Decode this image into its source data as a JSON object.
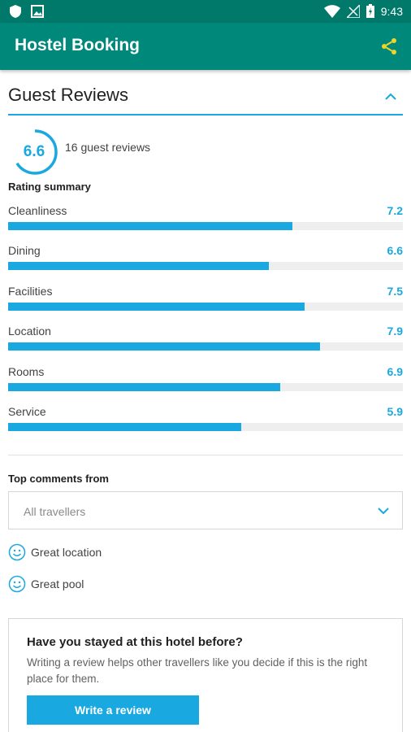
{
  "status_bar": {
    "time": "9:43"
  },
  "app_bar": {
    "title": "Hostel Booking"
  },
  "section": {
    "title": "Guest Reviews"
  },
  "overall": {
    "score": "6.6",
    "score_fraction": 0.66,
    "reviews_count": "16 guest reviews"
  },
  "summary_label": "Rating summary",
  "ratings": [
    {
      "name": "Cleanliness",
      "score": "7.2",
      "value": 7.2
    },
    {
      "name": "Dining",
      "score": "6.6",
      "value": 6.6
    },
    {
      "name": "Facilities",
      "score": "7.5",
      "value": 7.5
    },
    {
      "name": "Location",
      "score": "7.9",
      "value": 7.9
    },
    {
      "name": "Rooms",
      "score": "6.9",
      "value": 6.9
    },
    {
      "name": "Service",
      "score": "5.9",
      "value": 5.9
    }
  ],
  "rating_max": 10,
  "top_comments": {
    "label": "Top comments from",
    "filter_value": "All travellers",
    "items": [
      "Great location",
      "Great pool"
    ]
  },
  "cta": {
    "title": "Have you stayed at this hotel before?",
    "description": "Writing a review helps other travellers like you decide if this is the right place for them.",
    "button_label": "Write a review"
  },
  "colors": {
    "primary": "#00897b",
    "status_bar": "#00796b",
    "accent": "#1aa8e0",
    "share_icon": "#f2d32c"
  },
  "icons": [
    "shield-icon",
    "image-icon",
    "wifi-icon",
    "signal-icon",
    "battery-icon",
    "share-icon",
    "chevron-up-icon",
    "chevron-down-icon",
    "smiley-icon"
  ]
}
